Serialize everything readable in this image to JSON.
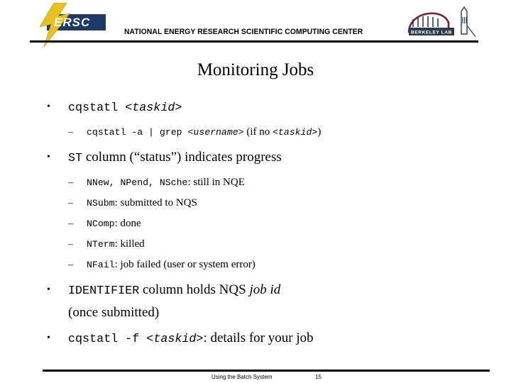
{
  "header": {
    "org_title": "NATIONAL ENERGY RESEARCH SCIENTIFIC COMPUTING CENTER",
    "nersc_logo_text": "ERSC",
    "nersc_logo_icon": "lightning-bolt-icon",
    "nersc_logo_box_color": "#1f3864",
    "nersc_bolt_color": "#e8c020",
    "lbl_logo_label": "BERKELEY LAB",
    "lbl_logo_icon": "berkeley-lab-dome-icon",
    "lbl_dome_color": "#7b1f2b",
    "lbl_building_color": "#2a3b52"
  },
  "slide": {
    "title": "Monitoring Jobs"
  },
  "bullets": [
    {
      "level": 1,
      "marker": "•",
      "parts": [
        {
          "style": "mono",
          "text": "cqstatl "
        },
        {
          "style": "mono-i",
          "text": "<taskid>"
        }
      ]
    },
    {
      "level": 2,
      "marker": "–",
      "parts": [
        {
          "style": "mono",
          "text": "cqstatl -a | grep "
        },
        {
          "style": "mono-i",
          "text": "<username>"
        },
        {
          "style": "serif",
          "text": " (if no "
        },
        {
          "style": "mono-i",
          "text": "<taskid>"
        },
        {
          "style": "serif",
          "text": ")"
        }
      ]
    },
    {
      "level": 1,
      "marker": "•",
      "parts": [
        {
          "style": "mono",
          "text": "ST"
        },
        {
          "style": "serif",
          "text": " column (“status”) indicates progress"
        }
      ]
    },
    {
      "level": 2,
      "marker": "–",
      "parts": [
        {
          "style": "mono",
          "text": "NNew, NPend, NSche"
        },
        {
          "style": "serif",
          "text": ": still in NQE"
        }
      ]
    },
    {
      "level": 2,
      "marker": "–",
      "parts": [
        {
          "style": "mono",
          "text": "NSubm"
        },
        {
          "style": "serif",
          "text": ": submitted to NQS"
        }
      ]
    },
    {
      "level": 2,
      "marker": "–",
      "parts": [
        {
          "style": "mono",
          "text": "NComp"
        },
        {
          "style": "serif",
          "text": ": done"
        }
      ]
    },
    {
      "level": 2,
      "marker": "–",
      "parts": [
        {
          "style": "mono",
          "text": "NTerm"
        },
        {
          "style": "serif",
          "text": ": killed"
        }
      ]
    },
    {
      "level": 2,
      "marker": "–",
      "parts": [
        {
          "style": "mono",
          "text": "NFail"
        },
        {
          "style": "serif",
          "text": ": job failed (user or system error)"
        }
      ]
    },
    {
      "level": 1,
      "marker": "•",
      "parts": [
        {
          "style": "mono",
          "text": "IDENTIFIER"
        },
        {
          "style": "serif",
          "text": " column holds NQS "
        },
        {
          "style": "serif-i",
          "text": "job id"
        }
      ]
    },
    {
      "level": 0,
      "marker": "",
      "parts": [
        {
          "style": "serif",
          "text": "(once submitted)"
        }
      ]
    },
    {
      "level": 1,
      "marker": "•",
      "parts": [
        {
          "style": "mono",
          "text": " cqstatl -f "
        },
        {
          "style": "mono-i",
          "text": "<taskid>"
        },
        {
          "style": "serif",
          "text": ": details for your job"
        }
      ]
    }
  ],
  "footer": {
    "deck_title": "Using the Batch System",
    "page_number": "15"
  }
}
